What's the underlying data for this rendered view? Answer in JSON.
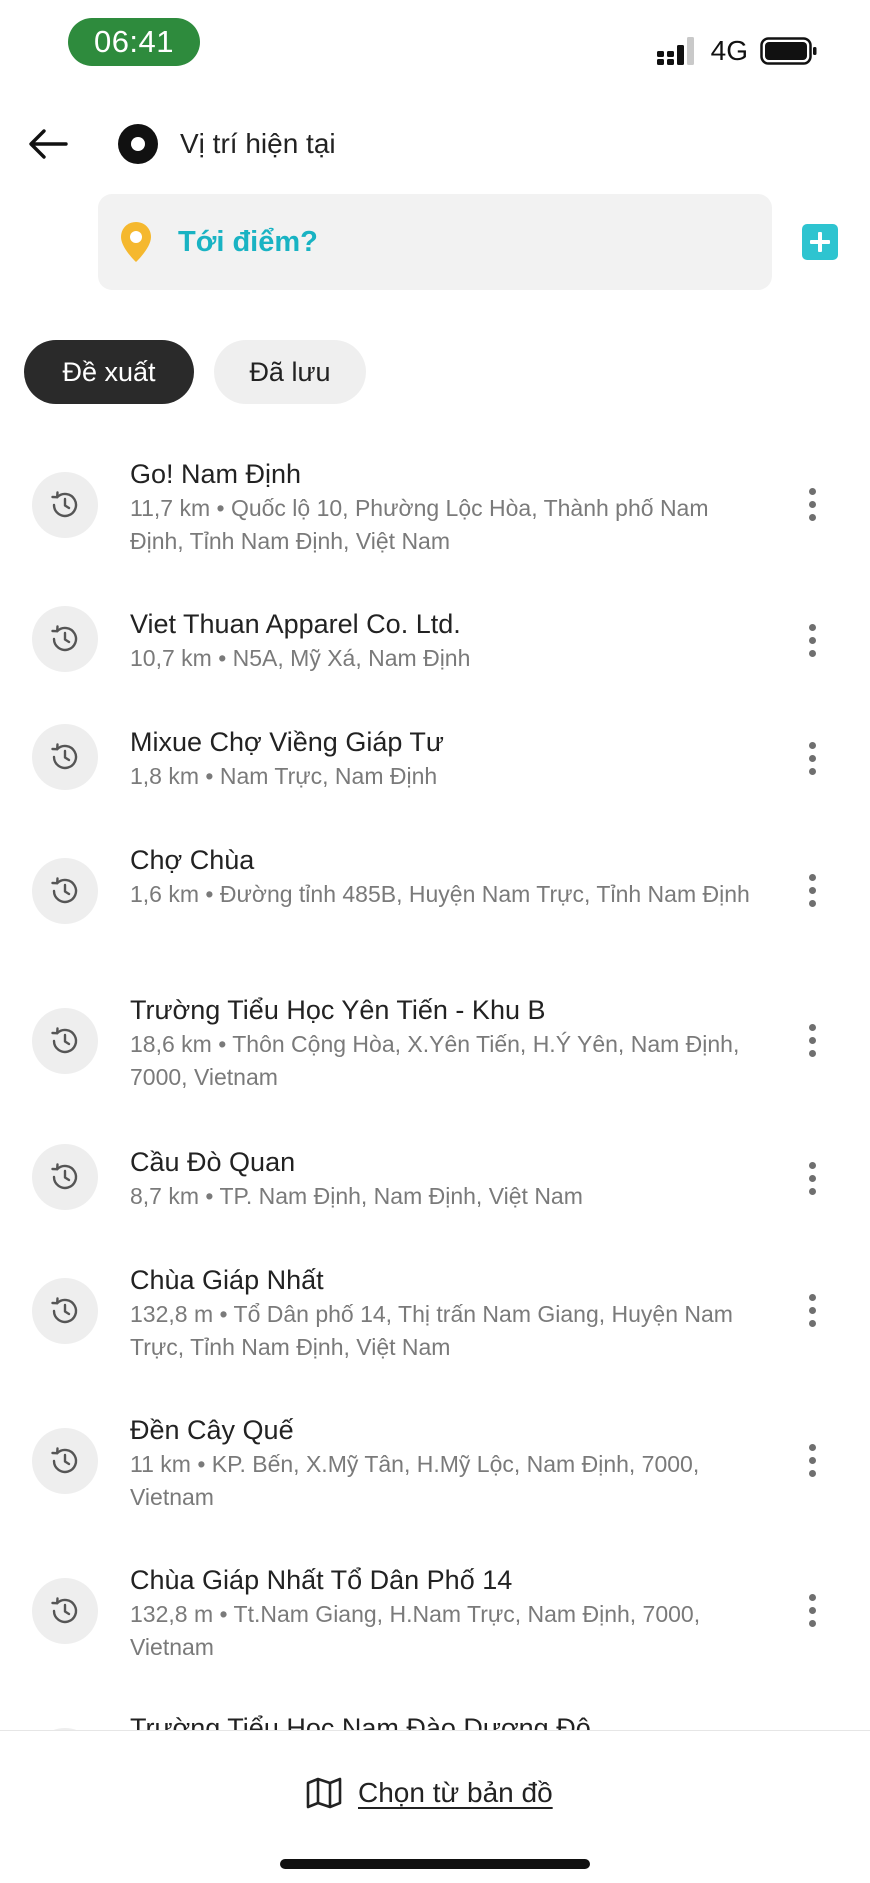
{
  "status_bar": {
    "time": "06:41",
    "network": "4G"
  },
  "header": {
    "origin_label": "Vị trí hiện tại",
    "destination_placeholder": "Tới điểm?"
  },
  "tabs": [
    {
      "label": "Đề xuất",
      "active": true
    },
    {
      "label": "Đã lưu",
      "active": false
    }
  ],
  "places": [
    {
      "title": "Go! Nam Định",
      "subtitle": "11,7 km • Quốc lộ 10, Phường Lộc Hòa, Thành phố Nam Định, Tỉnh Nam Định, Việt Nam"
    },
    {
      "title": "Viet Thuan Apparel Co. Ltd.",
      "subtitle": "10,7 km • N5A, Mỹ Xá, Nam Định"
    },
    {
      "title": "Mixue Chợ Viềng Giáp Tư",
      "subtitle": "1,8 km • Nam Trực, Nam Định"
    },
    {
      "title": "Chợ Chùa",
      "subtitle": "1,6 km • Đường tỉnh 485B, Huyện Nam Trực, Tỉnh Nam Định"
    },
    {
      "title": "Trường Tiểu Học Yên Tiến - Khu B",
      "subtitle": "18,6 km • Thôn Cộng Hòa, X.Yên Tiến, H.Ý Yên, Nam Định, 7000, Vietnam"
    },
    {
      "title": "Cầu Đò Quan",
      "subtitle": "8,7 km • TP. Nam Định, Nam Định, Việt Nam"
    },
    {
      "title": "Chùa Giáp Nhất",
      "subtitle": "132,8 m  • Tổ Dân phố 14, Thị trấn Nam Giang, Huyện Nam Trực, Tỉnh Nam Định, Việt Nam"
    },
    {
      "title": "Đền Cây Quế",
      "subtitle": "11 km • KP. Bến, X.Mỹ Tân, H.Mỹ Lộc, Nam Định, 7000, Vietnam"
    },
    {
      "title": "Chùa Giáp Nhất Tổ Dân Phố 14",
      "subtitle": "132,8 m  • Tt.Nam Giang, H.Nam Trực, Nam Định, 7000, Vietnam"
    },
    {
      "title": "Trường Tiểu Học Nam Đào Dương Đô",
      "subtitle": ""
    }
  ],
  "bottom_bar": {
    "pick_on_map_label": "Chọn từ bản đồ"
  },
  "colors": {
    "time_pill": "#2e8b3d",
    "accent_teal": "#19b3c3",
    "pin_yellow": "#f5b82e",
    "active_tab": "#2a2a2a"
  },
  "icons": [
    "signal-icon",
    "battery-icon",
    "back-arrow-icon",
    "current-location-icon",
    "pin-icon",
    "plus-icon",
    "history-icon",
    "more-vertical-icon",
    "map-icon"
  ]
}
